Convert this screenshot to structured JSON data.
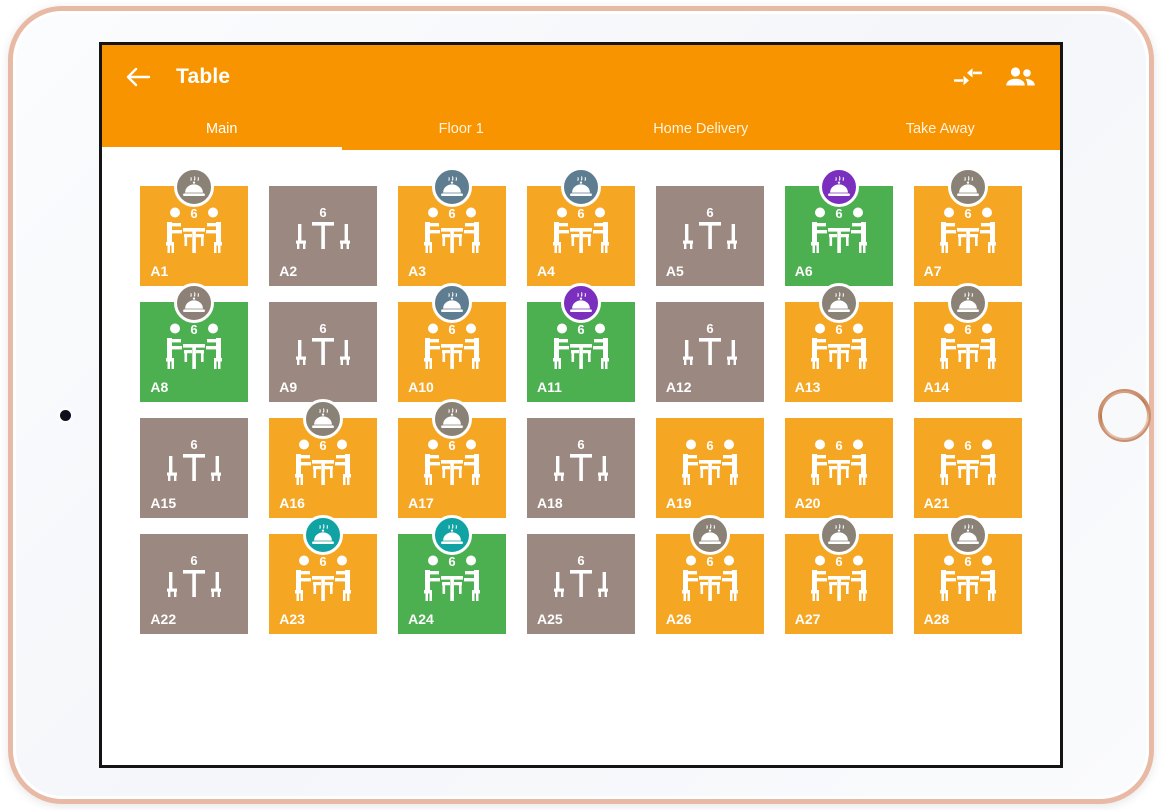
{
  "device": {
    "type": "tablet",
    "camera": "camera-dot",
    "home_button": "home-button"
  },
  "appbar": {
    "title": "Table",
    "back_icon": "arrow-left-icon",
    "actions": [
      {
        "name": "merge-tables-icon",
        "label": "Merge Tables"
      },
      {
        "name": "group-people-icon",
        "label": "Customers"
      }
    ],
    "accent": "#f79400"
  },
  "tabs": [
    {
      "label": "Main",
      "active": true
    },
    {
      "label": "Floor 1",
      "active": false
    },
    {
      "label": "Home Delivery",
      "active": false
    },
    {
      "label": "Take Away",
      "active": false
    }
  ],
  "legend_colors": {
    "occupied": "#f5a623",
    "free": "#9b8880",
    "reserved": "#4caf50",
    "badge_gray": "#8a8177",
    "badge_slate": "#5e7d91",
    "badge_purple": "#7b2fbe",
    "badge_teal": "#11a3a3",
    "badge_taupe": "#8d8076"
  },
  "grid": {
    "columns": 7,
    "rows": [
      [
        {
          "name": "A1",
          "seats": "6",
          "state": "occupied",
          "icon": "table-occupied-icon",
          "badge": "cloche-icon",
          "badge_color": "#8a8177"
        },
        {
          "name": "A2",
          "seats": "6",
          "state": "free",
          "icon": "table-empty-icon",
          "badge": null,
          "badge_color": null
        },
        {
          "name": "A3",
          "seats": "6",
          "state": "occupied",
          "icon": "table-occupied-icon",
          "badge": "cloche-icon",
          "badge_color": "#5e7d91"
        },
        {
          "name": "A4",
          "seats": "6",
          "state": "occupied",
          "icon": "table-occupied-icon",
          "badge": "cloche-icon",
          "badge_color": "#5e7d91"
        },
        {
          "name": "A5",
          "seats": "6",
          "state": "free",
          "icon": "table-empty-icon",
          "badge": null,
          "badge_color": null
        },
        {
          "name": "A6",
          "seats": "6",
          "state": "reserved",
          "icon": "table-occupied-icon",
          "badge": "cloche-icon",
          "badge_color": "#7b2fbe"
        },
        {
          "name": "A7",
          "seats": "6",
          "state": "occupied",
          "icon": "table-occupied-icon",
          "badge": "cloche-icon",
          "badge_color": "#8a8177"
        }
      ],
      [
        {
          "name": "A8",
          "seats": "6",
          "state": "reserved",
          "icon": "table-occupied-icon",
          "badge": "cloche-icon",
          "badge_color": "#8d8076"
        },
        {
          "name": "A9",
          "seats": "6",
          "state": "free",
          "icon": "table-empty-icon",
          "badge": null,
          "badge_color": null
        },
        {
          "name": "A10",
          "seats": "6",
          "state": "occupied",
          "icon": "table-occupied-icon",
          "badge": "cloche-icon",
          "badge_color": "#5e7d91"
        },
        {
          "name": "A11",
          "seats": "6",
          "state": "reserved",
          "icon": "table-occupied-icon",
          "badge": "cloche-icon",
          "badge_color": "#7b2fbe"
        },
        {
          "name": "A12",
          "seats": "6",
          "state": "free",
          "icon": "table-empty-icon",
          "badge": null,
          "badge_color": null
        },
        {
          "name": "A13",
          "seats": "6",
          "state": "occupied",
          "icon": "table-occupied-icon",
          "badge": "cloche-icon",
          "badge_color": "#8a8177"
        },
        {
          "name": "A14",
          "seats": "6",
          "state": "occupied",
          "icon": "table-occupied-icon",
          "badge": "cloche-icon",
          "badge_color": "#8a8177"
        }
      ],
      [
        {
          "name": "A15",
          "seats": "6",
          "state": "free",
          "icon": "table-empty-icon",
          "badge": null,
          "badge_color": null
        },
        {
          "name": "A16",
          "seats": "6",
          "state": "occupied",
          "icon": "table-occupied-icon",
          "badge": "cloche-icon",
          "badge_color": "#8a8177"
        },
        {
          "name": "A17",
          "seats": "6",
          "state": "occupied",
          "icon": "table-occupied-icon",
          "badge": "cloche-icon",
          "badge_color": "#8a8177"
        },
        {
          "name": "A18",
          "seats": "6",
          "state": "free",
          "icon": "table-empty-icon",
          "badge": null,
          "badge_color": null
        },
        {
          "name": "A19",
          "seats": "6",
          "state": "occupied",
          "icon": "table-occupied-icon",
          "badge": null,
          "badge_color": null
        },
        {
          "name": "A20",
          "seats": "6",
          "state": "occupied",
          "icon": "table-occupied-icon",
          "badge": null,
          "badge_color": null
        },
        {
          "name": "A21",
          "seats": "6",
          "state": "occupied",
          "icon": "table-occupied-icon",
          "badge": null,
          "badge_color": null
        }
      ],
      [
        {
          "name": "A22",
          "seats": "6",
          "state": "free",
          "icon": "table-empty-icon",
          "badge": null,
          "badge_color": null
        },
        {
          "name": "A23",
          "seats": "6",
          "state": "occupied",
          "icon": "table-occupied-icon",
          "badge": "cloche-icon",
          "badge_color": "#11a3a3"
        },
        {
          "name": "A24",
          "seats": "6",
          "state": "reserved",
          "icon": "table-occupied-icon",
          "badge": "cloche-icon",
          "badge_color": "#11a3a3"
        },
        {
          "name": "A25",
          "seats": "6",
          "state": "free",
          "icon": "table-empty-icon",
          "badge": null,
          "badge_color": null
        },
        {
          "name": "A26",
          "seats": "6",
          "state": "occupied",
          "icon": "table-occupied-icon",
          "badge": "cloche-icon",
          "badge_color": "#8a8177"
        },
        {
          "name": "A27",
          "seats": "6",
          "state": "occupied",
          "icon": "table-occupied-icon",
          "badge": "cloche-icon",
          "badge_color": "#8a8177"
        },
        {
          "name": "A28",
          "seats": "6",
          "state": "occupied",
          "icon": "table-occupied-icon",
          "badge": "cloche-icon",
          "badge_color": "#8a8177"
        }
      ]
    ]
  }
}
